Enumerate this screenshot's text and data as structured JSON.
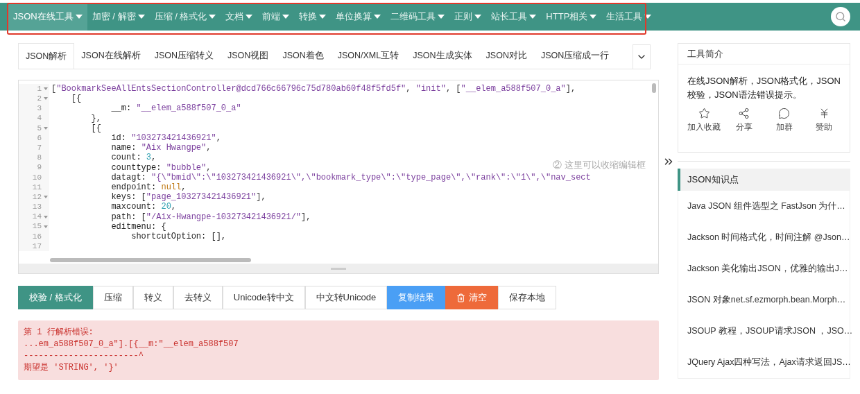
{
  "nav": {
    "items": [
      {
        "label": "JSON在线工具",
        "selected": true
      },
      {
        "label": "加密 / 解密",
        "selected": false
      },
      {
        "label": "压缩 / 格式化",
        "selected": false
      },
      {
        "label": "文档",
        "selected": false
      },
      {
        "label": "前端",
        "selected": false
      },
      {
        "label": "转换",
        "selected": false
      },
      {
        "label": "单位换算",
        "selected": false
      },
      {
        "label": "二维码工具",
        "selected": false
      },
      {
        "label": "正则",
        "selected": false
      },
      {
        "label": "站长工具",
        "selected": false
      },
      {
        "label": "HTTP相关",
        "selected": false
      },
      {
        "label": "生活工具",
        "selected": false
      }
    ],
    "highlighted": true
  },
  "tabs": [
    {
      "label": "JSON解析",
      "selected": true
    },
    {
      "label": "JSON在线解析",
      "selected": false
    },
    {
      "label": "JSON压缩转义",
      "selected": false
    },
    {
      "label": "JSON视图",
      "selected": false
    },
    {
      "label": "JSON着色",
      "selected": false
    },
    {
      "label": "JSON/XML互转",
      "selected": false
    },
    {
      "label": "JSON生成实体",
      "selected": false
    },
    {
      "label": "JSON对比",
      "selected": false
    },
    {
      "label": "JSON压缩成一行",
      "selected": false
    }
  ],
  "editor": {
    "hint": "② 这里可以收缩编辑框",
    "lines": [
      {
        "number": "1",
        "foldable": true,
        "tokens": [
          {
            "kind": "punct",
            "text": "["
          },
          {
            "kind": "string",
            "text": "\"BookmarkSeeAllEntsSectionController@dcd766c66796c75d780ab60f48f5fd5f\""
          },
          {
            "kind": "punct",
            "text": ", "
          },
          {
            "kind": "string",
            "text": "\"init\""
          },
          {
            "kind": "punct",
            "text": ", ["
          },
          {
            "kind": "string",
            "text": "\"__elem_a588f507_0_a\""
          },
          {
            "kind": "punct",
            "text": "],"
          }
        ]
      },
      {
        "number": "2",
        "foldable": true,
        "tokens": [
          {
            "kind": "punct",
            "text": "    [{"
          }
        ]
      },
      {
        "number": "3",
        "foldable": false,
        "tokens": [
          {
            "kind": "key",
            "text": "            __m: "
          },
          {
            "kind": "string",
            "text": "\"__elem_a588f507_0_a\""
          }
        ]
      },
      {
        "number": "4",
        "foldable": false,
        "tokens": [
          {
            "kind": "punct",
            "text": "        },"
          }
        ]
      },
      {
        "number": "5",
        "foldable": true,
        "tokens": [
          {
            "kind": "punct",
            "text": "        [{"
          }
        ]
      },
      {
        "number": "6",
        "foldable": false,
        "tokens": [
          {
            "kind": "key",
            "text": "            id: "
          },
          {
            "kind": "string",
            "text": "\"103273421436921\""
          },
          {
            "kind": "punct",
            "text": ","
          }
        ]
      },
      {
        "number": "7",
        "foldable": false,
        "tokens": [
          {
            "kind": "key",
            "text": "            name: "
          },
          {
            "kind": "string",
            "text": "\"Aix Hwangpe\""
          },
          {
            "kind": "punct",
            "text": ","
          }
        ]
      },
      {
        "number": "8",
        "foldable": false,
        "tokens": [
          {
            "kind": "key",
            "text": "            count: "
          },
          {
            "kind": "number",
            "text": "3"
          },
          {
            "kind": "punct",
            "text": ","
          }
        ]
      },
      {
        "number": "9",
        "foldable": false,
        "tokens": [
          {
            "kind": "key",
            "text": "            counttype: "
          },
          {
            "kind": "string",
            "text": "\"bubble\""
          },
          {
            "kind": "punct",
            "text": ","
          }
        ]
      },
      {
        "number": "10",
        "foldable": false,
        "tokens": [
          {
            "kind": "key",
            "text": "            datagt: "
          },
          {
            "kind": "string",
            "text": "\"{\\\"bmid\\\":\\\"103273421436921\\\",\\\"bookmark_type\\\":\\\"type_page\\\",\\\"rank\\\":\\\"1\\\",\\\"nav_sect"
          }
        ]
      },
      {
        "number": "11",
        "foldable": false,
        "tokens": [
          {
            "kind": "key",
            "text": "            endpoint: "
          },
          {
            "kind": "null",
            "text": "null"
          },
          {
            "kind": "punct",
            "text": ","
          }
        ]
      },
      {
        "number": "12",
        "foldable": true,
        "tokens": [
          {
            "kind": "key",
            "text": "            keys: ["
          },
          {
            "kind": "string",
            "text": "\"page_103273421436921\""
          },
          {
            "kind": "punct",
            "text": "],"
          }
        ]
      },
      {
        "number": "13",
        "foldable": false,
        "tokens": [
          {
            "kind": "key",
            "text": "            maxcount: "
          },
          {
            "kind": "number",
            "text": "20"
          },
          {
            "kind": "punct",
            "text": ","
          }
        ]
      },
      {
        "number": "14",
        "foldable": true,
        "tokens": [
          {
            "kind": "key",
            "text": "            path: ["
          },
          {
            "kind": "string",
            "text": "\"/Aix-Hwangpe-103273421436921/\""
          },
          {
            "kind": "punct",
            "text": "],"
          }
        ]
      },
      {
        "number": "15",
        "foldable": true,
        "tokens": [
          {
            "kind": "key",
            "text": "            editmenu: {"
          }
        ]
      },
      {
        "number": "16",
        "foldable": false,
        "tokens": [
          {
            "kind": "key",
            "text": "                shortcutOption: [],"
          }
        ]
      },
      {
        "number": "17",
        "foldable": false
      }
    ]
  },
  "actions": [
    {
      "label": "校验 / 格式化",
      "kind": "primary"
    },
    {
      "label": "压缩",
      "kind": "plain"
    },
    {
      "label": "转义",
      "kind": "plain"
    },
    {
      "label": "去转义",
      "kind": "plain"
    },
    {
      "label": "Unicode转中文",
      "kind": "plain"
    },
    {
      "label": "中文转Unicode",
      "kind": "plain"
    },
    {
      "label": "复制结果",
      "kind": "info"
    },
    {
      "label": "清空",
      "kind": "danger"
    },
    {
      "label": "保存本地",
      "kind": "plain"
    }
  ],
  "error": {
    "lines": [
      "第 1 行解析错误:",
      "...em_a588f507_0_a\"].[{__m:\"__elem_a588f507",
      "-----------------------^",
      "期望是 'STRING', '}'"
    ]
  },
  "sidebar": {
    "intro": {
      "title": "工具简介",
      "text": "在线JSON解析，JSON格式化，JSON校验，JSON语法错误提示。",
      "actions": [
        {
          "label": "加入收藏",
          "kind": "star"
        },
        {
          "label": "分享",
          "kind": "share"
        },
        {
          "label": "加群",
          "kind": "chat"
        },
        {
          "label": "赞助",
          "kind": "yen"
        }
      ]
    },
    "knowledge": {
      "title": "JSON知识点",
      "items": [
        "Java JSON 组件选型之 FastJson 为什…",
        "Jackson 时间格式化，时间注解 @Json…",
        "Jackson 美化输出JSON，优雅的输出J…",
        "JSON 对象net.sf.ezmorph.bean.Morph…",
        "JSOUP 教程，JSOUP请求JSON ，JSO…",
        "JQuery Ajax四种写法，Ajax请求返回JS…"
      ]
    }
  }
}
